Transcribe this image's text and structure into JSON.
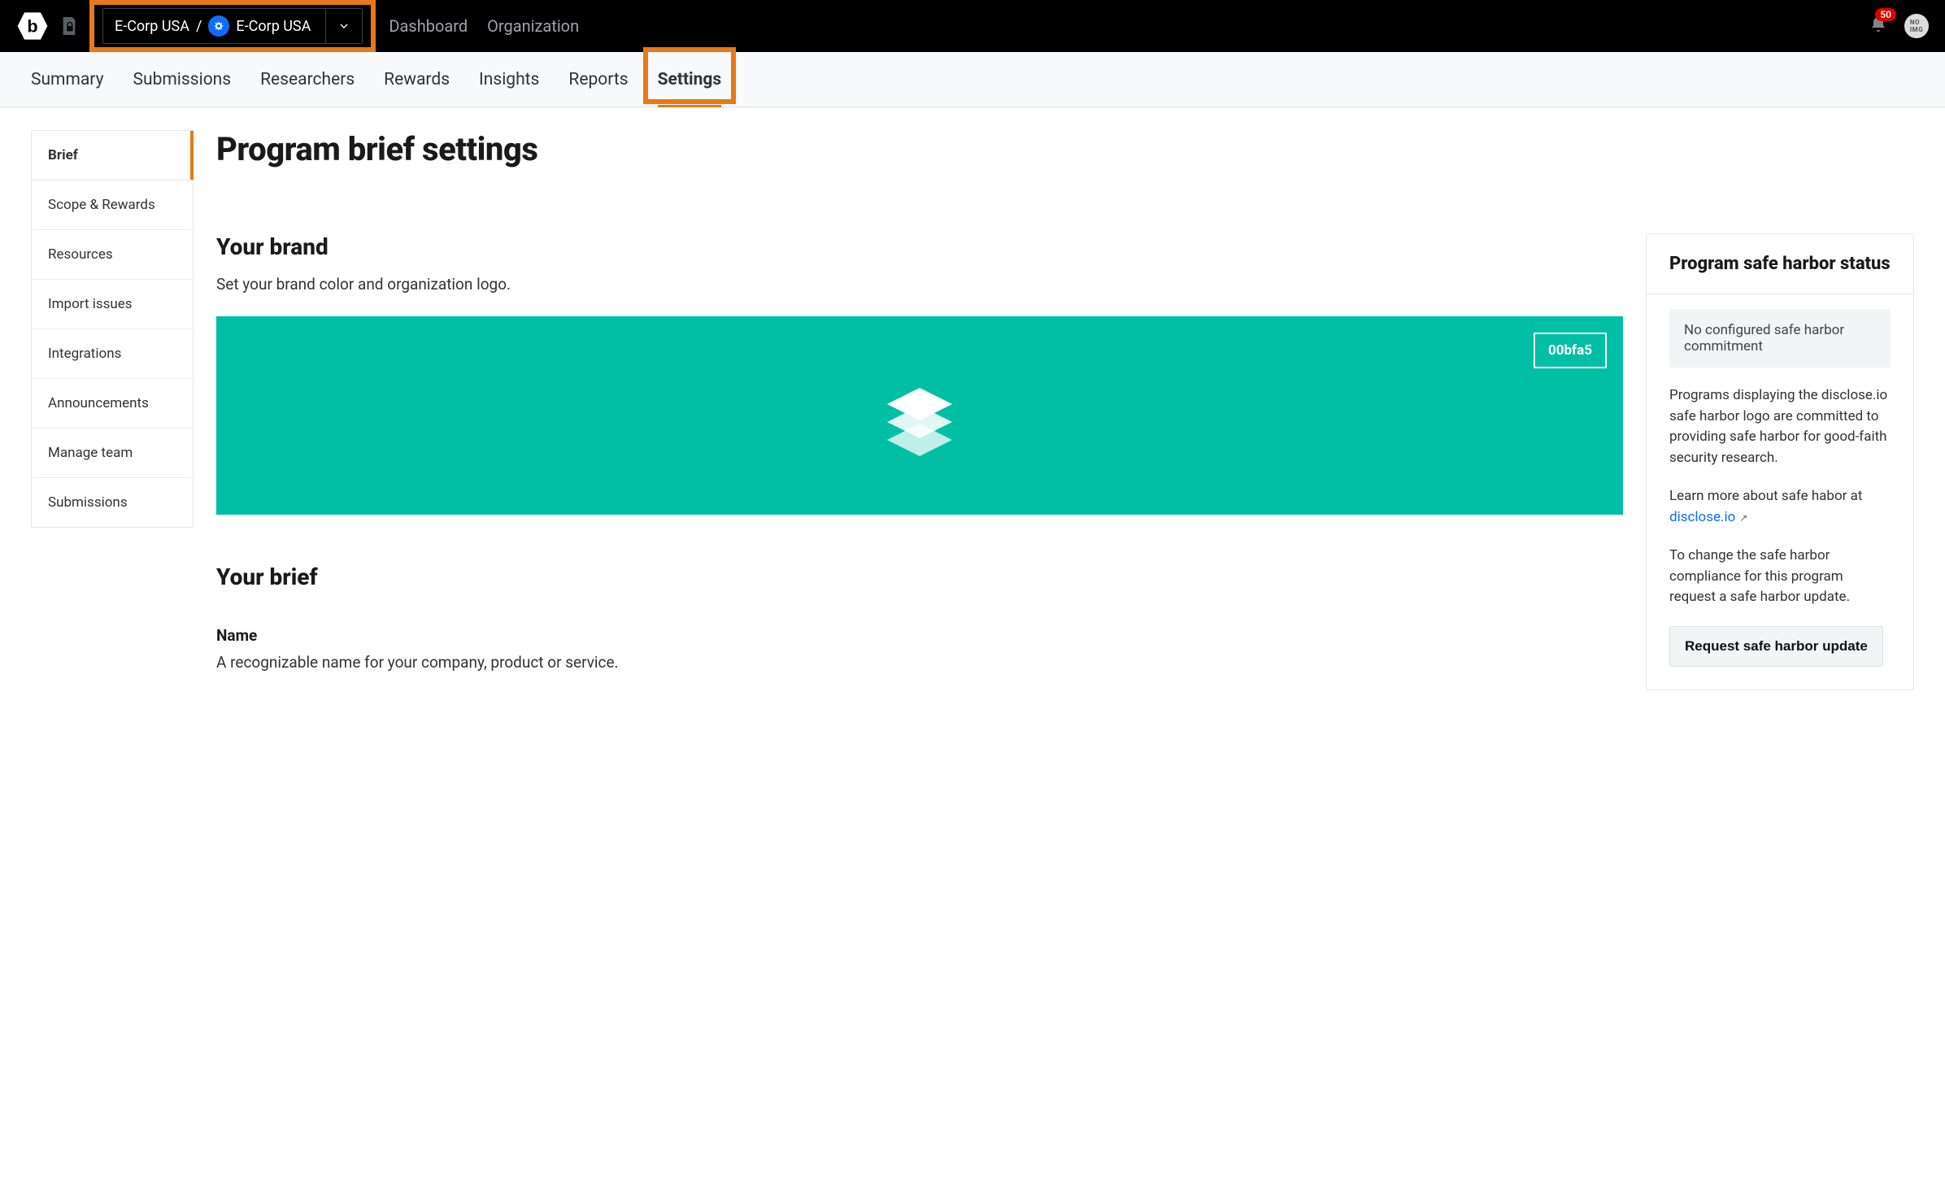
{
  "notifications": {
    "count": "50"
  },
  "program_switcher": {
    "org": "E-Corp USA",
    "separator": "/",
    "program": "E-Corp USA"
  },
  "topnav": {
    "dashboard": "Dashboard",
    "organization": "Organization"
  },
  "tabs": {
    "summary": "Summary",
    "submissions": "Submissions",
    "researchers": "Researchers",
    "rewards": "Rewards",
    "insights": "Insights",
    "reports": "Reports",
    "settings": "Settings"
  },
  "sidebar": {
    "brief": "Brief",
    "scope": "Scope & Rewards",
    "resources": "Resources",
    "import": "Import issues",
    "integrations": "Integrations",
    "announcements": "Announcements",
    "manage_team": "Manage team",
    "submissions": "Submissions"
  },
  "page": {
    "title": "Program brief settings"
  },
  "brand": {
    "heading": "Your brand",
    "desc": "Set your brand color and organization logo.",
    "color_hex": "00bfa5"
  },
  "brief": {
    "heading": "Your brief",
    "name_label": "Name",
    "name_help": "A recognizable name for your company, product or service."
  },
  "safeharbor": {
    "heading": "Program safe harbor status",
    "notice": "No configured safe harbor commitment",
    "p1": "Programs displaying the disclose.io safe harbor logo are committed to providing safe harbor for good-faith security research.",
    "p2a": "Learn more about safe habor at ",
    "p2link": "disclose.io",
    "p3": "To change the safe harbor compliance for this program request a safe harbor update.",
    "button": "Request safe harbor update"
  }
}
